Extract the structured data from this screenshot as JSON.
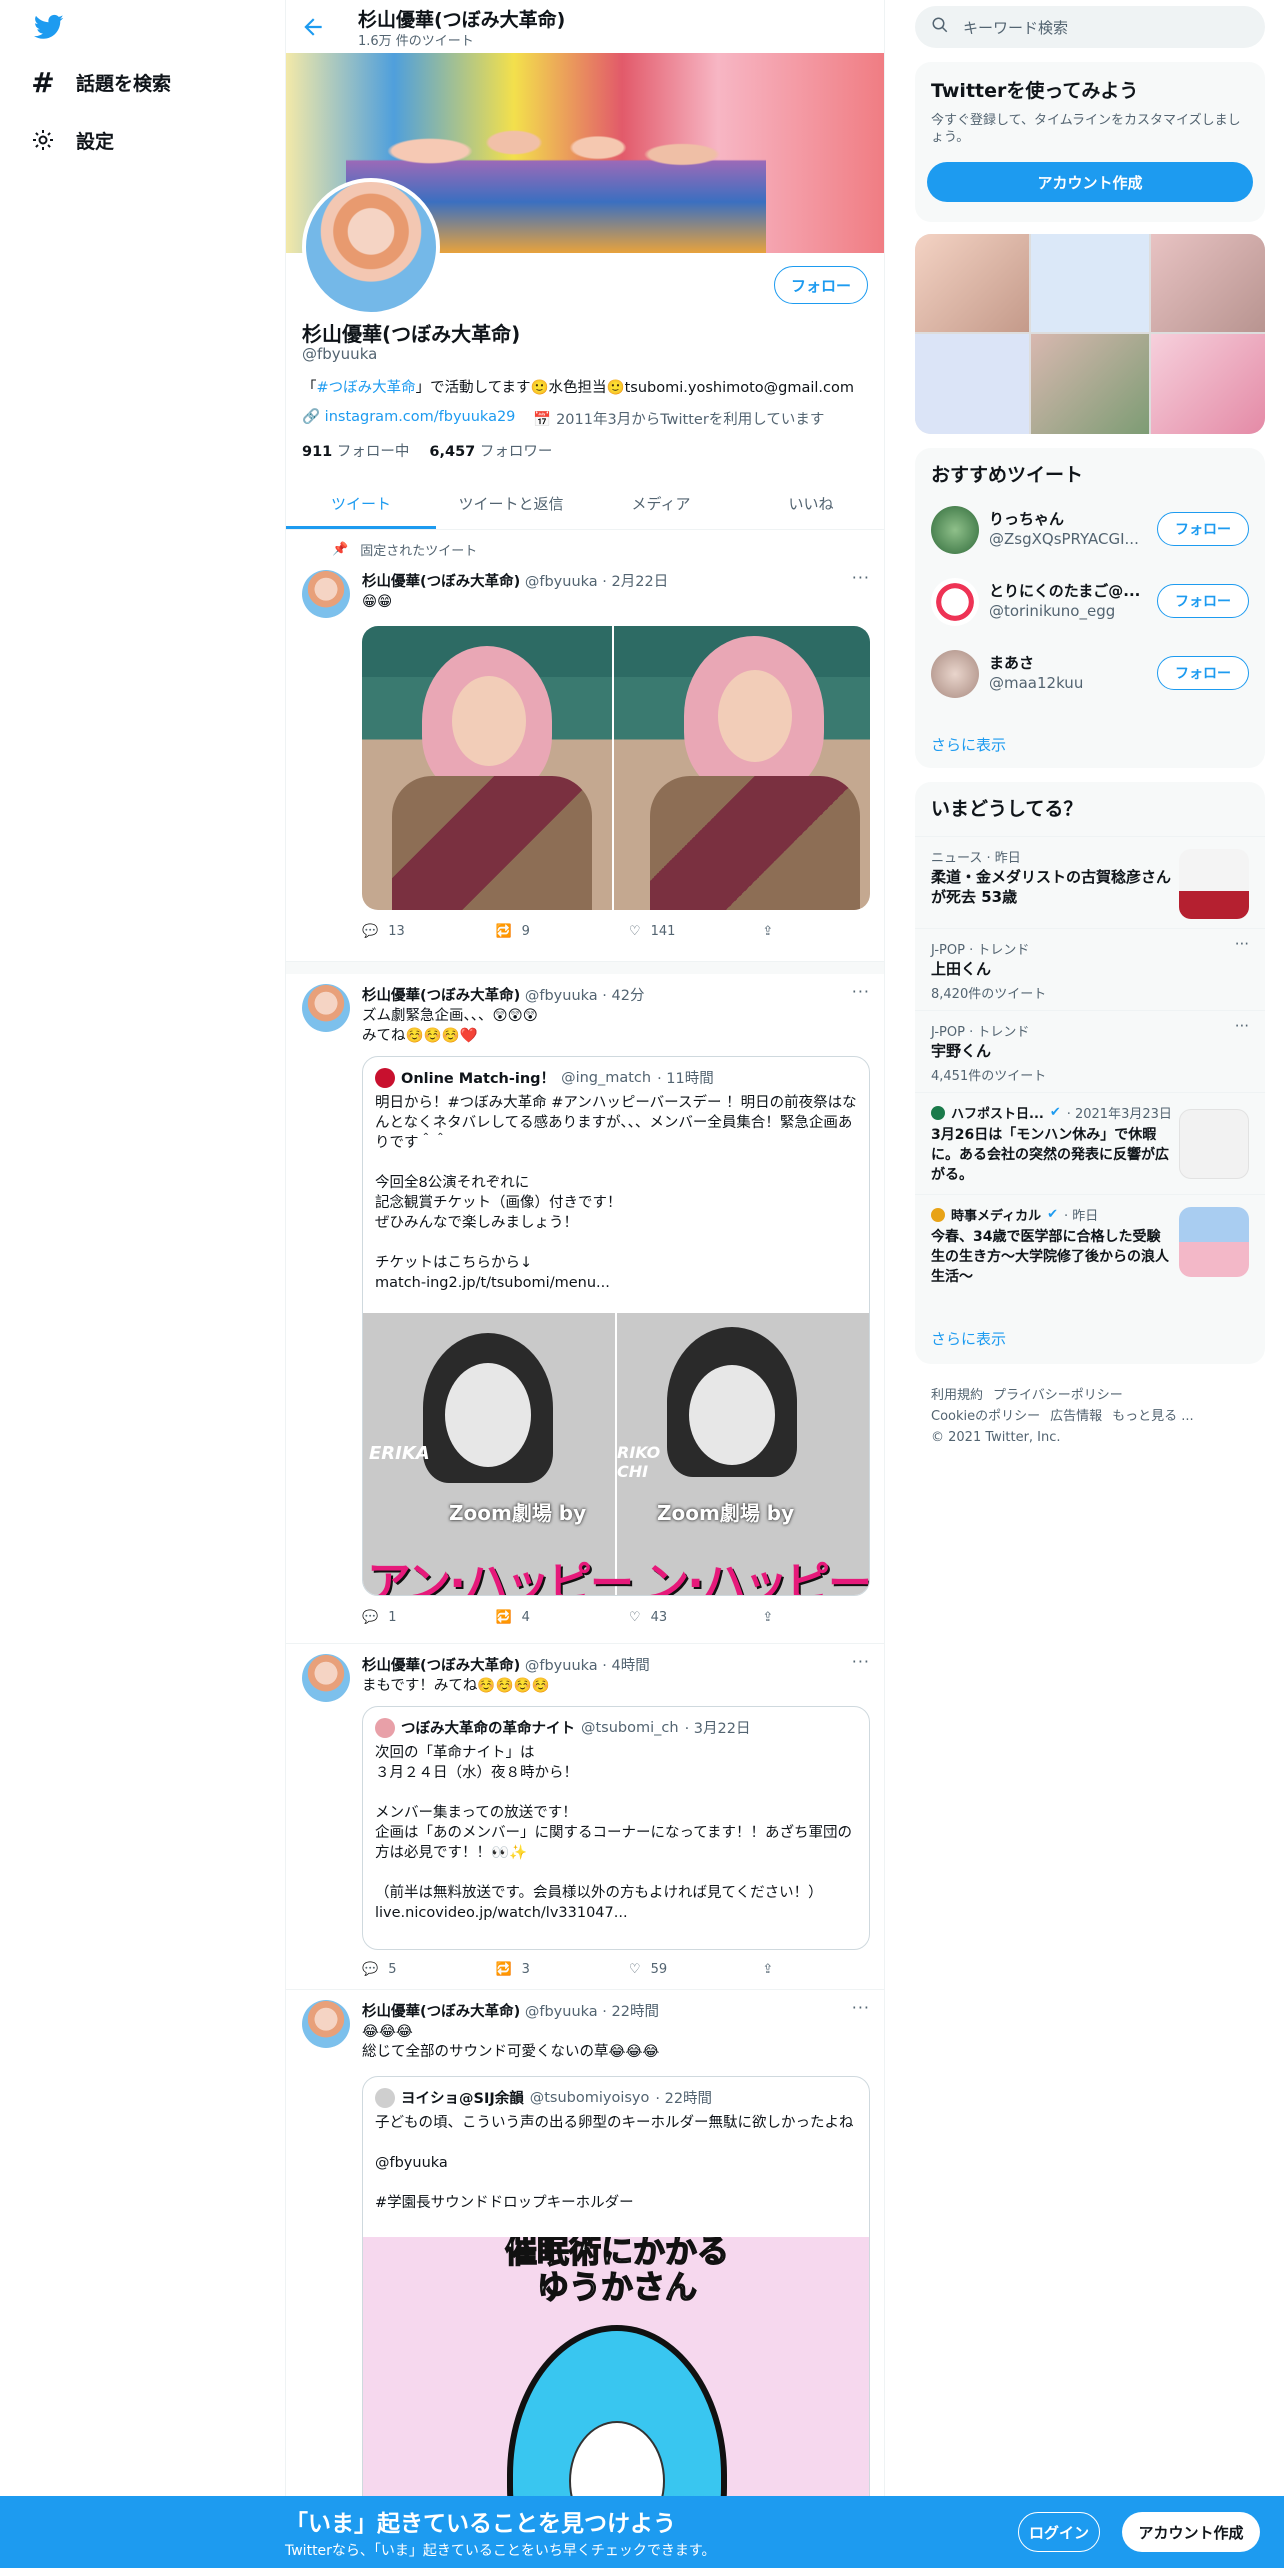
{
  "nav": {
    "explore_label": "話題を検索",
    "settings_label": "設定"
  },
  "header": {
    "name": "杉山優華(つぼみ大革命)",
    "tweet_count": "1.6万 件のツイート"
  },
  "profile": {
    "follow_label": "フォロー",
    "name": "杉山優華(つぼみ大革命)",
    "handle": "@fbyuuka",
    "bio_prefix": "「",
    "bio_hashtag": "#つぼみ大革命",
    "bio_rest": "」で活動してます🙂水色担当🙂tsubomi.yoshimoto@gmail.com",
    "website": "instagram.com/fbyuuka29",
    "joined": "2011年3月からTwitterを利用しています",
    "following_count": "911",
    "following_label": "フォロー中",
    "followers_count": "6,457",
    "followers_label": "フォロワー"
  },
  "tabs": [
    "ツイート",
    "ツイートと返信",
    "メディア",
    "いいね"
  ],
  "pinned_label": "固定されたツイート",
  "tweets": [
    {
      "name": "杉山優華(つぼみ大革命)",
      "handle": "@fbyuuka",
      "time": "· 2月22日",
      "text": "😁😁",
      "reply": "13",
      "retweet": "9",
      "like": "141"
    },
    {
      "name": "杉山優華(つぼみ大革命)",
      "handle": "@fbyuuka",
      "time": "· 42分",
      "text": "ズム劇緊急企画、、、😲😲😲\nみてね☺️☺️☺️❤️",
      "quote": {
        "name": "Online Match-ing！",
        "handle": "@ing_match",
        "time": "· 11時間",
        "text": "明日から！#つぼみ大革命 #アンハッピーバースデー ！明日の前夜祭はなんとなくネタバレしてる感ありますが、、、メンバー全員集合！緊急企画ありです＾＾\n\n今回全8公演それぞれに\n記念観賞チケット（画像）付きです！\nぜひみんなで楽しみましょう！\n\nチケットはこちらから↓\nmatch-ing2.jp/t/tsubomi/menu...",
        "image_caption_1": "Zoom劇場 by",
        "image_caption_2": "Zoom劇場 by",
        "image_banner": "アン·ハッピー ン·ハッピーバ",
        "image_name_1": "ERIKA",
        "image_name_2": "RIKO CHI"
      },
      "reply": "1",
      "retweet": "4",
      "like": "43"
    },
    {
      "name": "杉山優華(つぼみ大革命)",
      "handle": "@fbyuuka",
      "time": "· 4時間",
      "text": "まもです！みてね☺️☺️☺️☺️",
      "quote": {
        "name": "つぼみ大革命の革命ナイト",
        "handle": "@tsubomi_ch",
        "time": "· 3月22日",
        "text": "次回の「革命ナイト」は\n３月２４日（水）夜８時から！\n\nメンバー集まっての放送です！\n企画は「あのメンバー」に関するコーナーになってます！！あざち軍団の方は必見です！！👀✨\n\n（前半は無料放送です。会員様以外の方もよければ見てください！）\nlive.nicovideo.jp/watch/lv331047..."
      },
      "reply": "5",
      "retweet": "3",
      "like": "59"
    },
    {
      "name": "杉山優華(つぼみ大革命)",
      "handle": "@fbyuuka",
      "time": "· 22時間",
      "text": "😂😂😂\n総じて全部のサウンド可愛くないの草😂😂😂",
      "quote": {
        "name": "ヨイショ@SIJ余韻",
        "handle": "@tsubomiyoisyo",
        "time": "· 22時間",
        "text": "子どもの頃、こういう声の出る卵型のキーホルダー無駄に欲しかったよね\n\n@fbyuuka\n\n#学園長サウンドドロップキーホルダー",
        "image_text": "催眠術にかかる\nゆうかさん"
      }
    }
  ],
  "right": {
    "search_placeholder": "キーワード検索",
    "signup_card": {
      "title": "Twitterを使ってみよう",
      "subtitle": "今すぐ登録して、タイムラインをカスタマイズしましょう。",
      "button": "アカウント作成"
    },
    "recommend": {
      "title": "おすすめツイート",
      "follow_label": "フォロー",
      "users": [
        {
          "name": "りっちゃん",
          "handle": "@ZsgXQsPRYACGI..."
        },
        {
          "name": "とりにくのたまご@...",
          "handle": "@torinikuno_egg"
        },
        {
          "name": "まあさ",
          "handle": "@maa12kuu"
        }
      ],
      "more": "さらに表示"
    },
    "trends": {
      "title": "いまどうしてる？",
      "items": [
        {
          "meta": "ニュース · 昨日",
          "title": "柔道・金メダリストの古賀稔彦さんが死去 53歳"
        },
        {
          "meta": "J-POP · トレンド",
          "title": "上田くん",
          "count": "8,420件のツイート"
        },
        {
          "meta": "J-POP · トレンド",
          "title": "宇野くん",
          "count": "4,451件のツイート"
        },
        {
          "meta_source": "ハフポスト日...",
          "meta": "· 2021年3月23日",
          "title": "3月26日は「モンハン休み」で休暇に。ある会社の突然の発表に反響が広がる。"
        },
        {
          "meta_source": "時事メディカル",
          "meta": "· 昨日",
          "title": "今春、34歳で医学部に合格した受験生の生き方～大学院修了後からの浪人生活～"
        }
      ],
      "more": "さらに表示"
    },
    "footer": {
      "links": [
        "利用規約",
        "プライバシーポリシー",
        "Cookieのポリシー",
        "広告情報",
        "もっと見る ..."
      ],
      "copyright": "© 2021 Twitter, Inc."
    }
  },
  "bottom": {
    "title": "「いま」起きていることを見つけよう",
    "subtitle": "Twitterなら、「いま」起きていることをいち早くチェックできます。",
    "login": "ログイン",
    "signup": "アカウント作成"
  },
  "colors": {
    "brand": "#1d9bf0",
    "text": "#0f1419",
    "muted": "#536471",
    "like": "#536471"
  }
}
